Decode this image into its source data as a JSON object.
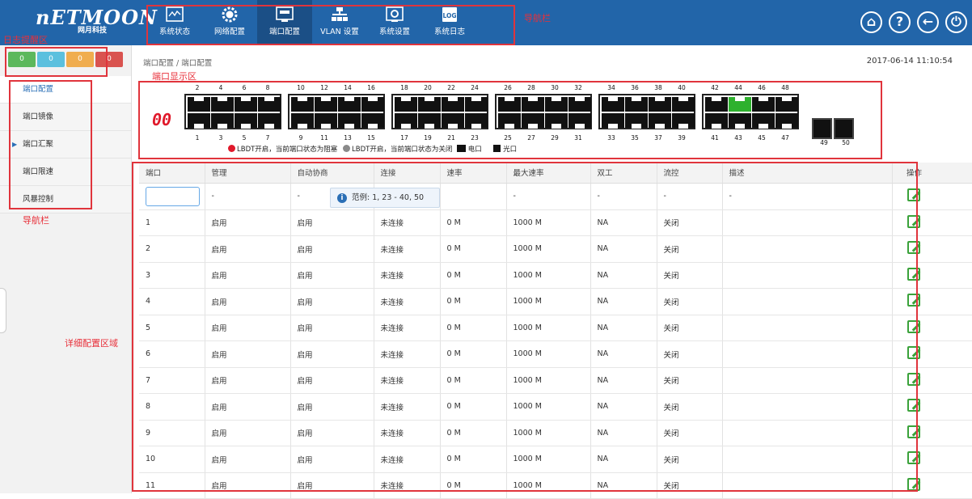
{
  "logo": {
    "main": "nETMOON",
    "sub": "网月科技"
  },
  "nav": [
    {
      "label": "系统状态"
    },
    {
      "label": "网络配置"
    },
    {
      "label": "端口配置"
    },
    {
      "label": "VLAN 设置"
    },
    {
      "label": "系统设置"
    },
    {
      "label": "系统日志",
      "icon_text": "LOG"
    }
  ],
  "annotations": {
    "nav_top": "导航栏",
    "alert": "日志提醒区",
    "port_display": "端口显示区",
    "nav_left": "导航栏",
    "detail": "详细配置区域"
  },
  "top_icons": [
    "home-icon",
    "help-icon",
    "back-icon",
    "power-icon"
  ],
  "badges": [
    {
      "value": "0",
      "color": "#5cb85c"
    },
    {
      "value": "0",
      "color": "#5bc0de"
    },
    {
      "value": "0",
      "color": "#f0ad4e"
    },
    {
      "value": "0",
      "color": "#d9534f"
    }
  ],
  "sidebar": [
    {
      "label": "端口配置"
    },
    {
      "label": "端口镜像"
    },
    {
      "label": "端口汇聚"
    },
    {
      "label": "端口限速"
    },
    {
      "label": "风暴控制"
    }
  ],
  "breadcrumb": "端口配置 / 端口配置",
  "datetime": "2017-06-14 11:10:54",
  "port_panel": {
    "segment_display": "00",
    "sfp_labels": [
      "49",
      "50"
    ],
    "legend": {
      "blocked": "LBDT开启，当前端口状态为阻塞",
      "closed": "LBDT开启，当前端口状态为关闭",
      "electric": "电口",
      "optical": "光口"
    },
    "green_port": 44
  },
  "table": {
    "headers": [
      "端口",
      "管理",
      "自动协商",
      "连接",
      "速率",
      "最大速率",
      "双工",
      "流控",
      "描述",
      "操作"
    ],
    "filter": {
      "dash": "-",
      "tooltip": "范例: 1, 23 - 40, 50"
    },
    "rows": [
      [
        "1",
        "启用",
        "启用",
        "未连接",
        "0 M",
        "1000 M",
        "NA",
        "关闭"
      ],
      [
        "2",
        "启用",
        "启用",
        "未连接",
        "0 M",
        "1000 M",
        "NA",
        "关闭"
      ],
      [
        "3",
        "启用",
        "启用",
        "未连接",
        "0 M",
        "1000 M",
        "NA",
        "关闭"
      ],
      [
        "4",
        "启用",
        "启用",
        "未连接",
        "0 M",
        "1000 M",
        "NA",
        "关闭"
      ],
      [
        "5",
        "启用",
        "启用",
        "未连接",
        "0 M",
        "1000 M",
        "NA",
        "关闭"
      ],
      [
        "6",
        "启用",
        "启用",
        "未连接",
        "0 M",
        "1000 M",
        "NA",
        "关闭"
      ],
      [
        "7",
        "启用",
        "启用",
        "未连接",
        "0 M",
        "1000 M",
        "NA",
        "关闭"
      ],
      [
        "8",
        "启用",
        "启用",
        "未连接",
        "0 M",
        "1000 M",
        "NA",
        "关闭"
      ],
      [
        "9",
        "启用",
        "启用",
        "未连接",
        "0 M",
        "1000 M",
        "NA",
        "关闭"
      ],
      [
        "10",
        "启用",
        "启用",
        "未连接",
        "0 M",
        "1000 M",
        "NA",
        "关闭"
      ],
      [
        "11",
        "启用",
        "启用",
        "未连接",
        "0 M",
        "1000 M",
        "NA",
        "关闭"
      ]
    ]
  }
}
